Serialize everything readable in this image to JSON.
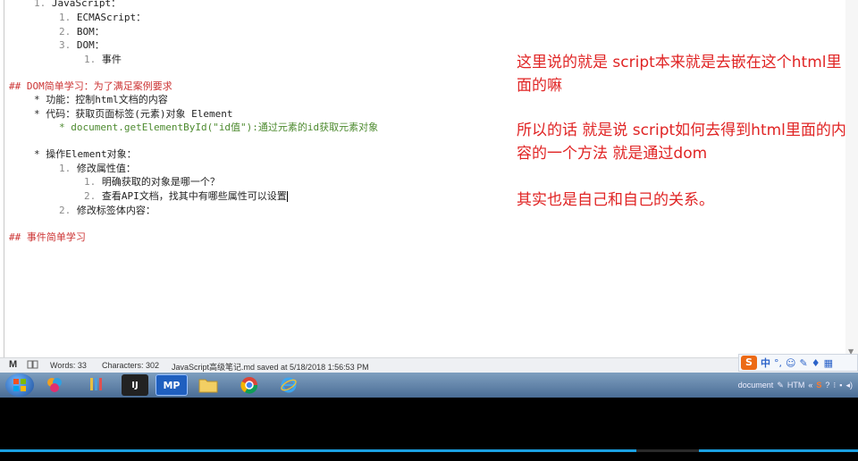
{
  "editor": {
    "lines": [
      {
        "num": "1.",
        "text": "JavaScript："
      },
      {
        "num": "1.",
        "text": "ECMAScript："
      },
      {
        "num": "2.",
        "text": "BOM："
      },
      {
        "num": "3.",
        "text": "DOM："
      },
      {
        "num": "1.",
        "text": "事件"
      },
      {
        "heading": "## DOM简单学习：为了满足案例要求"
      },
      {
        "bullet": "*",
        "text": "功能：控制html文档的内容"
      },
      {
        "bullet": "*",
        "text": "代码：获取页面标签(元素)对象 Element"
      },
      {
        "bullet": "*",
        "text": "document.getElementById(\"id值\"):通过元素的id获取元素对象"
      },
      {
        "bullet": "*",
        "text": "操作Element对象："
      },
      {
        "num": "1.",
        "text": "修改属性值："
      },
      {
        "num": "1.",
        "text": "明确获取的对象是哪一个？"
      },
      {
        "num": "2.",
        "text": "查看API文档，找其中有哪些属性可以设置"
      },
      {
        "num": "2.",
        "text": "修改标签体内容："
      },
      {
        "heading": "## 事件简单学习"
      }
    ]
  },
  "notes": [
    "这里说的就是  script本来就是去嵌在这个html里面的嘛",
    "所以的话  就是说  script如何去得到html里面的内容的一个方法 就是通过dom",
    "其实也是自己和自己的关系。"
  ],
  "status_bar": {
    "words": "Words: 33",
    "characters": "Characters: 302",
    "saved": "JavaScript高级笔记.md saved at 5/18/2018 1:56:53 PM"
  },
  "ime": {
    "logo": "S",
    "lang": "中"
  },
  "taskbar": {
    "mp_label": "MP",
    "ij_label": "IJ",
    "tray_document": "document",
    "tray_htm": "HTM"
  },
  "colors": {
    "note_red": "#e02424",
    "heading_red": "#cc3333",
    "code_green": "#4d8a2f",
    "taskbar_blue": "#4a6d96",
    "accent_bar": "#1ba1e2"
  }
}
